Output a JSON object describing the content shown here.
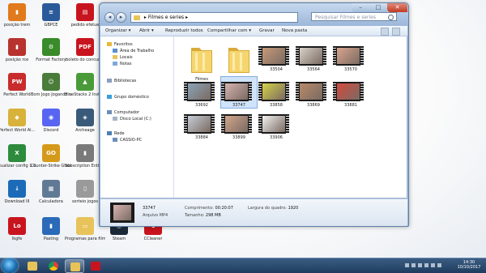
{
  "desktop": {
    "icons": [
      {
        "label": "posição trem",
        "color": "#e07a1c",
        "glyph": "▮"
      },
      {
        "label": "posição rce",
        "color": "#b8322e",
        "glyph": "▮"
      },
      {
        "label": "Perfect World",
        "color": "#c92c2c",
        "glyph": "PW"
      },
      {
        "label": "Perfect World Ai...",
        "color": "#d8b23a",
        "glyph": "◆"
      },
      {
        "label": "atualizar config 1.0.xls",
        "color": "#2e8b3d",
        "glyph": "X"
      },
      {
        "label": "Download III",
        "color": "#1c6bb8",
        "glyph": "↓"
      },
      {
        "label": "lkgfe",
        "color": "#c8141e",
        "glyph": "Lo"
      },
      {
        "label": "GBPCE",
        "color": "#2a5a9a",
        "glyph": "≡"
      },
      {
        "label": "Format Factory",
        "color": "#3a8b2a",
        "glyph": "⚙"
      },
      {
        "label": "Bom Jogo Jogando no Centro",
        "color": "#4a7c3a",
        "glyph": "☺"
      },
      {
        "label": "Discord",
        "color": "#5865f2",
        "glyph": "◉"
      },
      {
        "label": "Counter-Strike Global Offensive",
        "color": "#d69a1a",
        "glyph": "GO"
      },
      {
        "label": "Calculadora",
        "color": "#607a96",
        "glyph": "▦"
      },
      {
        "label": "pedido efetue",
        "color": "#c8141e",
        "glyph": "▤"
      },
      {
        "label": "boleto do concurso",
        "color": "#c8141e",
        "glyph": "PDF"
      },
      {
        "label": "BlueStacks 2 Installer",
        "color": "#4a9a3a",
        "glyph": "▲"
      },
      {
        "label": "Archeage",
        "color": "#3a5a7a",
        "glyph": "◈"
      },
      {
        "label": "Subscription Entire Songs",
        "color": "#7a7a7a",
        "glyph": "▮"
      },
      {
        "label": "sorteio jogos",
        "color": "#9a9a9a",
        "glyph": "▯"
      },
      {
        "label": "Pasting",
        "color": "#2a6ab8",
        "glyph": "▮"
      },
      {
        "label": "Programas para filmes",
        "color": "#e8c35a",
        "glyph": "▭"
      },
      {
        "label": "Steam",
        "color": "#1b2838",
        "glyph": "◎"
      },
      {
        "label": "CCleaner",
        "color": "#c8141e",
        "glyph": "C"
      }
    ]
  },
  "window": {
    "address": {
      "segments": [
        "Filmes e series"
      ],
      "separator": "▸"
    },
    "search_placeholder": "Pesquisar Filmes e series",
    "controls": {
      "minimize": "–",
      "maximize": "□",
      "close": "✕"
    },
    "toolbar": [
      "Organizar ▾",
      "Abrir ▾",
      "Reproduzir todos",
      "Compartilhar com ▾",
      "Gravar",
      "Nova pasta"
    ],
    "nav": {
      "favorites_label": "Favoritos",
      "favorites": [
        "Área de Trabalho",
        "Locais",
        "Notas"
      ],
      "libraries_label": "Bibliotecas",
      "homegroup_label": "Grupo doméstico",
      "computer_label": "Computador",
      "computer": [
        "Disco Local (C:)"
      ],
      "network_label": "Rede",
      "network": [
        "CASSIO-PC"
      ]
    },
    "items": [
      {
        "name": "Filmes",
        "kind": "folder"
      },
      {
        "name": "Series",
        "kind": "folder"
      },
      {
        "name": "33504",
        "kind": "video",
        "tone": "#c79a78"
      },
      {
        "name": "33564",
        "kind": "video",
        "tone": "#d8d2c8"
      },
      {
        "name": "33570",
        "kind": "video",
        "tone": "#d9a58e"
      },
      {
        "name": "33692",
        "kind": "video",
        "tone": "#8aa3b8"
      },
      {
        "name": "33747",
        "kind": "video",
        "tone": "#d7b3b0",
        "selected": true
      },
      {
        "name": "33858",
        "kind": "video",
        "tone": "#d6d246"
      },
      {
        "name": "33869",
        "kind": "video",
        "tone": "#b88a6a"
      },
      {
        "name": "33881",
        "kind": "video",
        "tone": "#d44a3e"
      },
      {
        "name": "33884",
        "kind": "video",
        "tone": "#c6cdd6"
      },
      {
        "name": "33899",
        "kind": "video",
        "tone": "#d2a68c"
      },
      {
        "name": "33906",
        "kind": "video",
        "tone": "#f2f2f2"
      }
    ],
    "details": {
      "name": "33747",
      "type": "Arquivo MP4",
      "length_label": "Comprimento:",
      "length": "00:20:07",
      "size_label": "Tamanho:",
      "size": "298 MB",
      "width_label": "Largura do quadro:",
      "width": "1920",
      "thumb_tone": "#d7b3b0"
    }
  },
  "taskbar": {
    "time": "14:30",
    "date": "10/10/2017",
    "apps": [
      "windows-explorer",
      "media-player",
      "chrome",
      "explorer-folder",
      "media-center",
      "jogos"
    ]
  },
  "colors": {
    "taskbar": "#2a4a70",
    "selection": "#cfe3fa",
    "folder": "#e8c35a"
  }
}
